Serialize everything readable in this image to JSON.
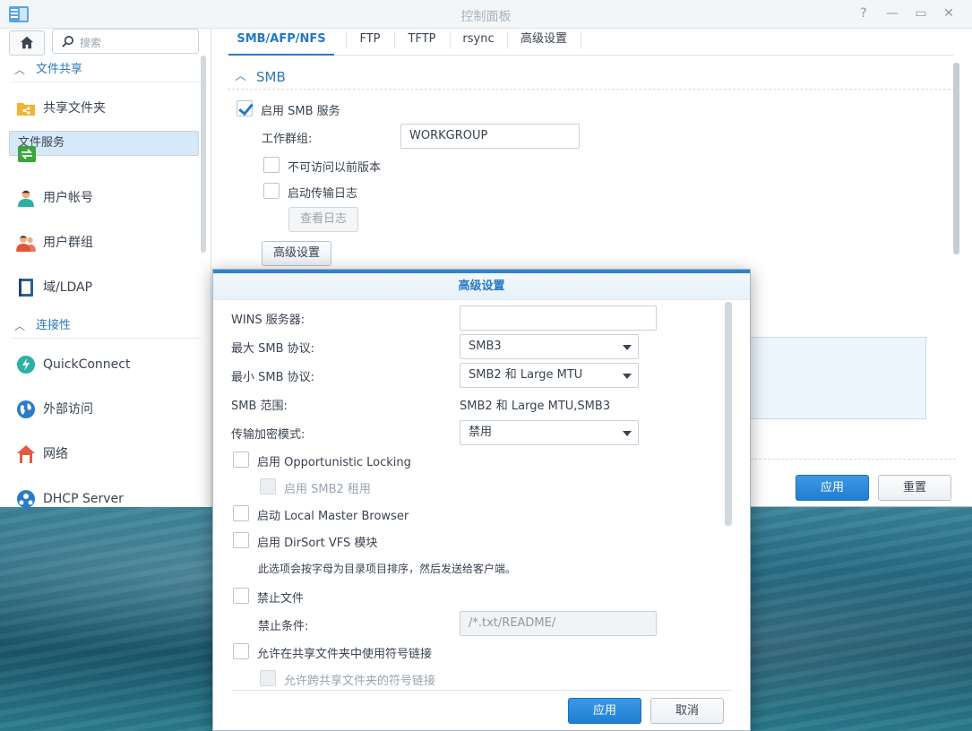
{
  "window": {
    "title": "控制面板"
  },
  "sidebar": {
    "search_placeholder": "搜索",
    "sections": [
      {
        "label": "文件共享"
      },
      {
        "label": "连接性"
      }
    ],
    "items": [
      {
        "label": "共享文件夹",
        "icon": "shared-folder-icon"
      },
      {
        "label": "文件服务",
        "icon": "file-services-icon"
      },
      {
        "label": "用户帐号",
        "icon": "user-icon"
      },
      {
        "label": "用户群组",
        "icon": "group-icon"
      },
      {
        "label": "域/LDAP",
        "icon": "ldap-icon"
      },
      {
        "label": "QuickConnect",
        "icon": "quickconnect-icon"
      },
      {
        "label": "外部访问",
        "icon": "globe-icon"
      },
      {
        "label": "网络",
        "icon": "network-icon"
      },
      {
        "label": "DHCP Server",
        "icon": "dhcp-icon"
      }
    ]
  },
  "tabs": [
    {
      "label": "SMB/AFP/NFS"
    },
    {
      "label": "FTP"
    },
    {
      "label": "TFTP"
    },
    {
      "label": "rsync"
    },
    {
      "label": "高级设置"
    }
  ],
  "smb": {
    "header": "SMB",
    "enable_label": "启用 SMB 服务",
    "workgroup_label": "工作群组:",
    "workgroup_value": "WORKGROUP",
    "prev_versions_label": "不可访问以前版本",
    "transfer_log_label": "启动传输日志",
    "view_log_button": "查看日志",
    "advanced_button": "高级设置"
  },
  "main_footer": {
    "apply": "应用",
    "reset": "重置"
  },
  "dialog": {
    "title": "高级设置",
    "wins_label": "WINS 服务器:",
    "wins_value": "",
    "max_smb_label": "最大 SMB 协议:",
    "max_smb_value": "SMB3",
    "min_smb_label": "最小 SMB 协议:",
    "min_smb_value": "SMB2 和 Large MTU",
    "range_label": "SMB 范围:",
    "range_value": "SMB2 和 Large MTU,SMB3",
    "encrypt_label": "传输加密模式:",
    "encrypt_value": "禁用",
    "oplock_label": "启用 Opportunistic Locking",
    "smb2_lease_label": "启用 SMB2 租用",
    "local_master_label": "启动 Local Master Browser",
    "dirsort_label": "启用 DirSort VFS 模块",
    "dirsort_desc": "此选项会按字母为目录项目排序，然后发送给客户端。",
    "veto_label": "禁止文件",
    "veto_cond_label": "禁止条件:",
    "veto_cond_placeholder": "/*.txt/README/",
    "symlink_label": "允许在共享文件夹中使用符号链接",
    "cross_symlink_label": "允许跨共享文件夹的符号链接",
    "apply": "应用",
    "cancel": "取消"
  },
  "colors": {
    "accent": "#2579c4",
    "selected_bg": "#d6e9f8",
    "primary_button": "#1f7fd2"
  }
}
